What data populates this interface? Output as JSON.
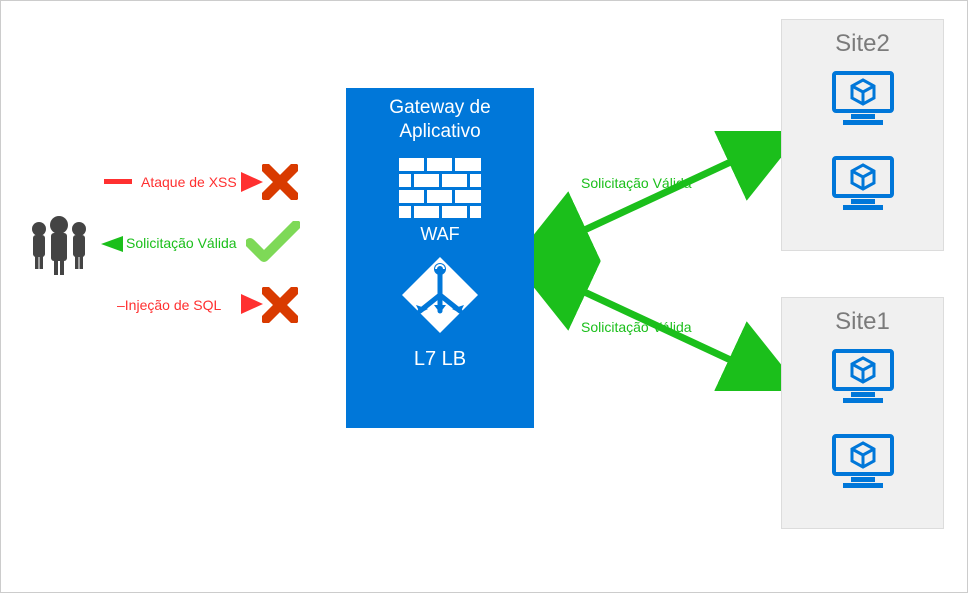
{
  "gateway": {
    "title_line1": "Gateway de",
    "title_line2": "Aplicativo",
    "waf_label": "WAF",
    "lb_label": "L7 LB"
  },
  "requests": {
    "xss_attack": "Ataque de XSS",
    "valid_request_left": "Solicitação Válida",
    "sql_injection": "Injeção de SQL",
    "valid_request_top": "Solicitação Válida",
    "valid_request_bottom": "Solicitação Válida"
  },
  "sites": {
    "site2_title": "Site2",
    "site1_title": "Site1"
  },
  "icons": {
    "users": "users-group-icon",
    "blocked": "blocked-x-icon",
    "allowed": "allowed-check-icon",
    "firewall": "brick-wall-icon",
    "loadbalancer": "loadbalancer-icon",
    "vm": "vm-monitor-icon"
  },
  "colors": {
    "azure_blue": "#0077d9",
    "green": "#1bbf1b",
    "red": "#ff3030",
    "gray_bg": "#f0f0f0",
    "gray_text": "#7b7b7b",
    "dark": "#444"
  }
}
